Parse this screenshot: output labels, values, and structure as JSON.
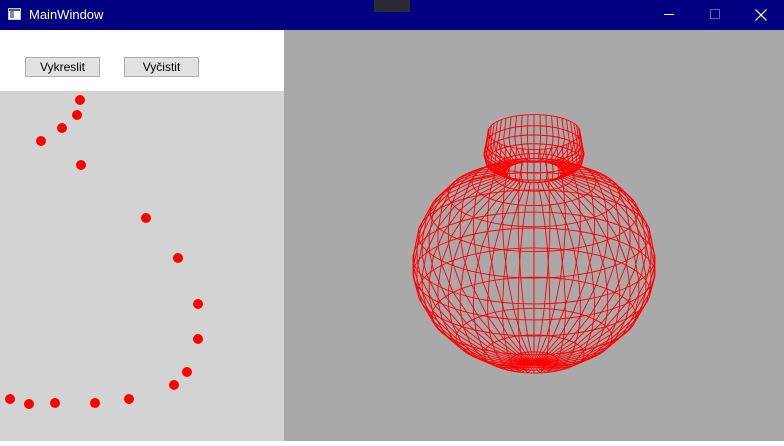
{
  "window": {
    "title": "MainWindow"
  },
  "toolbar": {
    "draw_label": "Vykreslit",
    "clear_label": "Vyčistit"
  },
  "colors": {
    "titlebar": "#000080",
    "canvas_background": "#d3d3d3",
    "viewport_background": "#a9a9a9",
    "point_color": "#ff0000",
    "mesh_color": "#ff0000"
  },
  "icons": [
    "app-window-icon",
    "minimize-icon",
    "maximize-icon",
    "close-icon"
  ]
}
